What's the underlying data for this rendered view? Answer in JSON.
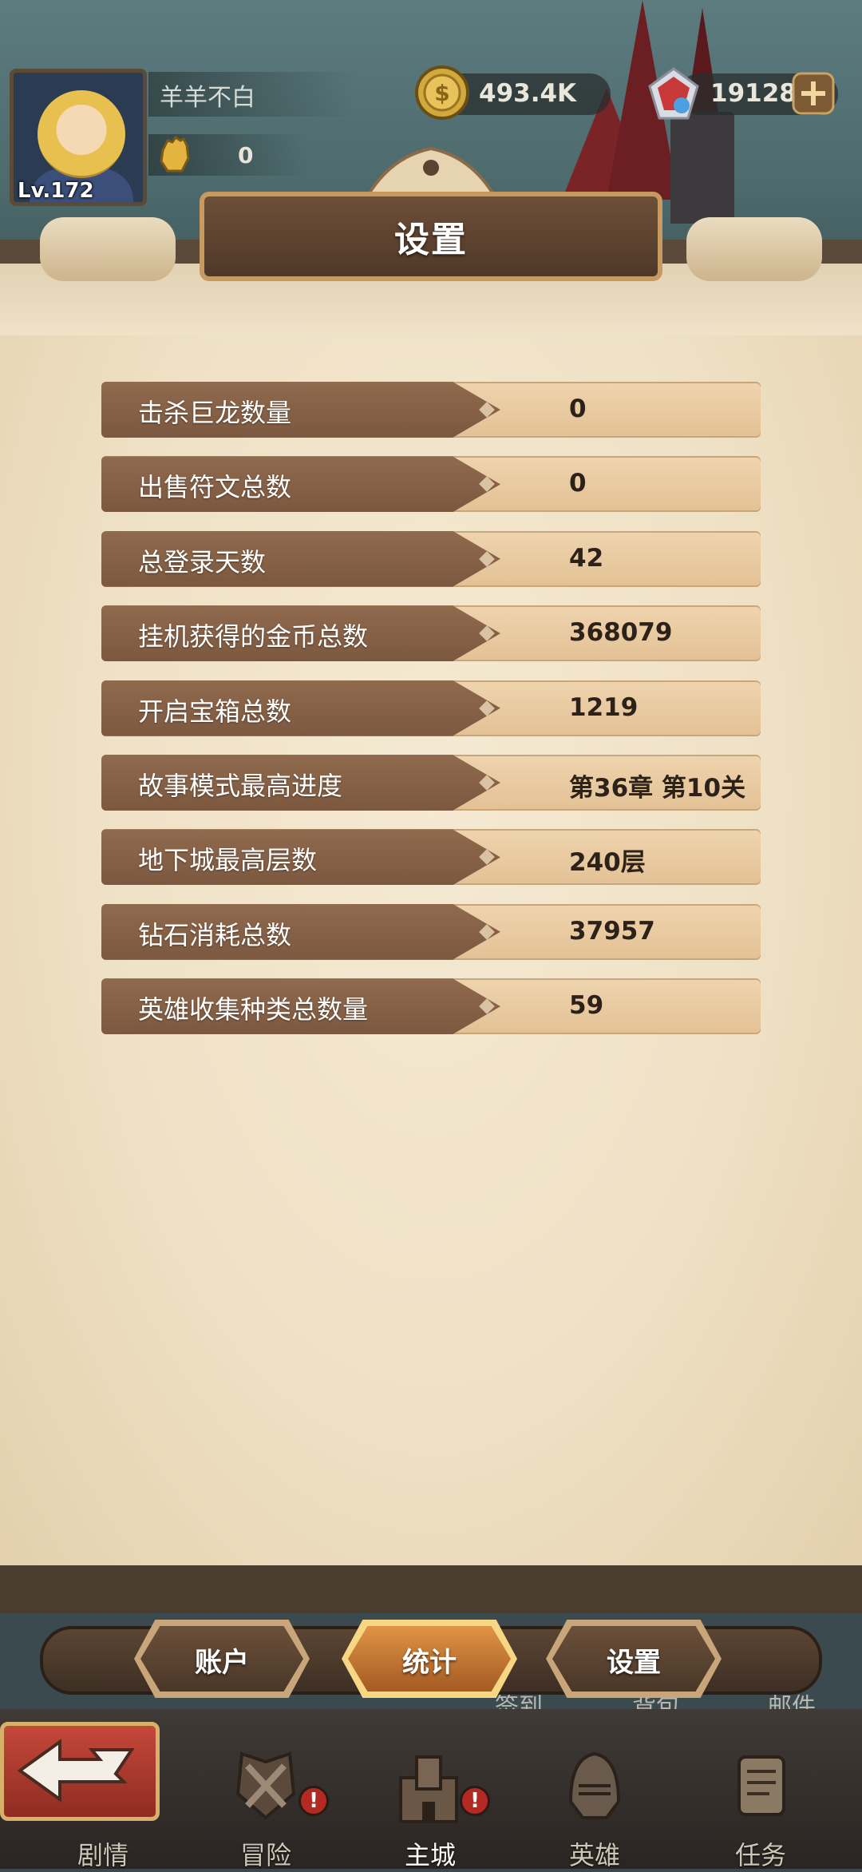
{
  "player": {
    "name": "羊羊不白",
    "level": "Lv.172",
    "power": "0"
  },
  "currency": {
    "gold": "493.4K",
    "gems": "19128"
  },
  "panel": {
    "title": "设置"
  },
  "stats": [
    {
      "label": "击杀巨龙数量",
      "value": "0"
    },
    {
      "label": "出售符文总数",
      "value": "0"
    },
    {
      "label": "总登录天数",
      "value": "42"
    },
    {
      "label": "挂机获得的金币总数",
      "value": "368079"
    },
    {
      "label": "开启宝箱总数",
      "value": "1219"
    },
    {
      "label": "故事模式最高进度",
      "value": "第36章 第10关"
    },
    {
      "label": "地下城最高层数",
      "value": "240层"
    },
    {
      "label": "钻石消耗总数",
      "value": "37957"
    },
    {
      "label": "英雄收集种类总数量",
      "value": "59"
    }
  ],
  "tabs": {
    "account": "账户",
    "stats": "统计",
    "settings": "设置",
    "active": "stats"
  },
  "shortcuts": {
    "checkin": "签到",
    "bag": "背包",
    "mail": "邮件"
  },
  "nav": {
    "story": "剧情",
    "adventure": "冒险",
    "city": "主城",
    "heroes": "英雄",
    "tasks": "任务",
    "active": "city",
    "alert_mark": "!"
  },
  "colors": {
    "parchment": "#efe1c5",
    "label_bg": "#7b583f",
    "active_tab": "#d88a3c",
    "alert": "#b22a22"
  }
}
